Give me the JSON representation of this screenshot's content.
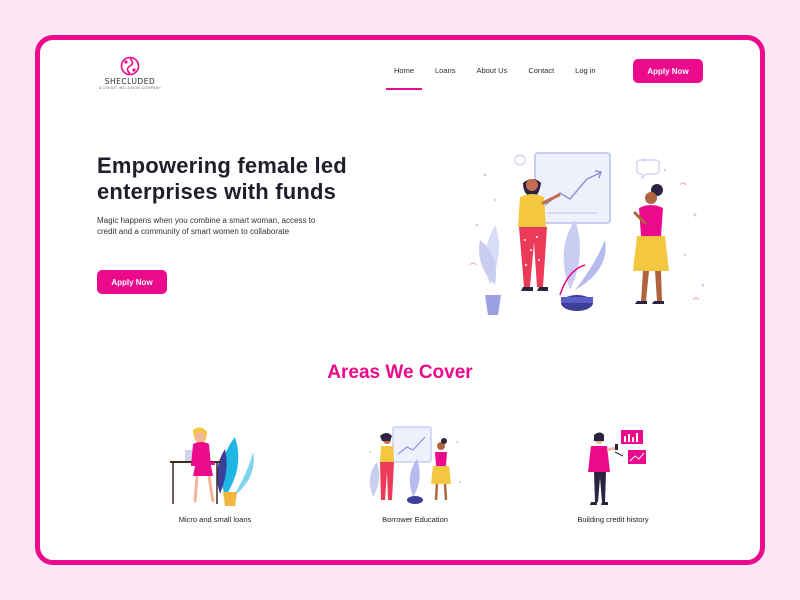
{
  "brand": {
    "name": "SHECLUDED",
    "tagline": "A CREDIT INCLUSION COMPANY",
    "accent_color": "#ec0a8c"
  },
  "nav": {
    "items": [
      {
        "label": "Home",
        "active": true
      },
      {
        "label": "Loans",
        "active": false
      },
      {
        "label": "About Us",
        "active": false
      },
      {
        "label": "Contact",
        "active": false
      },
      {
        "label": "Log in",
        "active": false
      }
    ],
    "apply_label": "Apply Now"
  },
  "hero": {
    "title": "Empowering female led enterprises with funds",
    "subtitle": "Magic happens when you combine a smart woman, access to credit and a community of smart women to collaborate",
    "apply_label": "Apply Now",
    "illustration": "two-women-presenting-growth-chart"
  },
  "areas": {
    "title": "Areas We Cover",
    "items": [
      {
        "label": "Micro and small loans",
        "icon": "woman-laptop-desk-illustration"
      },
      {
        "label": "Borrower Education",
        "icon": "women-presenting-chart-illustration"
      },
      {
        "label": "Building credit history",
        "icon": "woman-phone-charts-illustration"
      }
    ]
  }
}
